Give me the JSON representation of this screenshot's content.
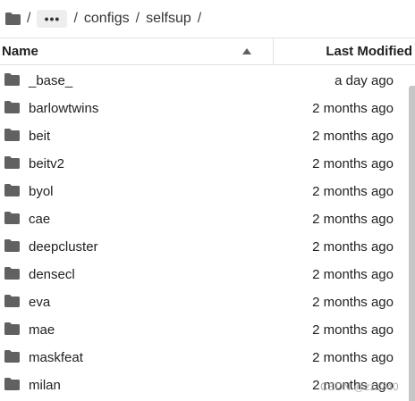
{
  "breadcrumb": {
    "ellipsis": "•••",
    "separator": "/",
    "items": [
      "configs",
      "selfsup"
    ]
  },
  "header": {
    "name_label": "Name",
    "modified_label": "Last Modified",
    "sort": "ascending"
  },
  "files": [
    {
      "name": "_base_",
      "modified": "a day ago"
    },
    {
      "name": "barlowtwins",
      "modified": "2 months ago"
    },
    {
      "name": "beit",
      "modified": "2 months ago"
    },
    {
      "name": "beitv2",
      "modified": "2 months ago"
    },
    {
      "name": "byol",
      "modified": "2 months ago"
    },
    {
      "name": "cae",
      "modified": "2 months ago"
    },
    {
      "name": "deepcluster",
      "modified": "2 months ago"
    },
    {
      "name": "densecl",
      "modified": "2 months ago"
    },
    {
      "name": "eva",
      "modified": "2 months ago"
    },
    {
      "name": "mae",
      "modified": "2 months ago"
    },
    {
      "name": "maskfeat",
      "modified": "2 months ago"
    },
    {
      "name": "milan",
      "modified": "2 months ago"
    }
  ],
  "watermark": "CSDN @zzz340",
  "colors": {
    "folder": "#616161",
    "text": "#212121",
    "divider": "#e0e0e0"
  }
}
